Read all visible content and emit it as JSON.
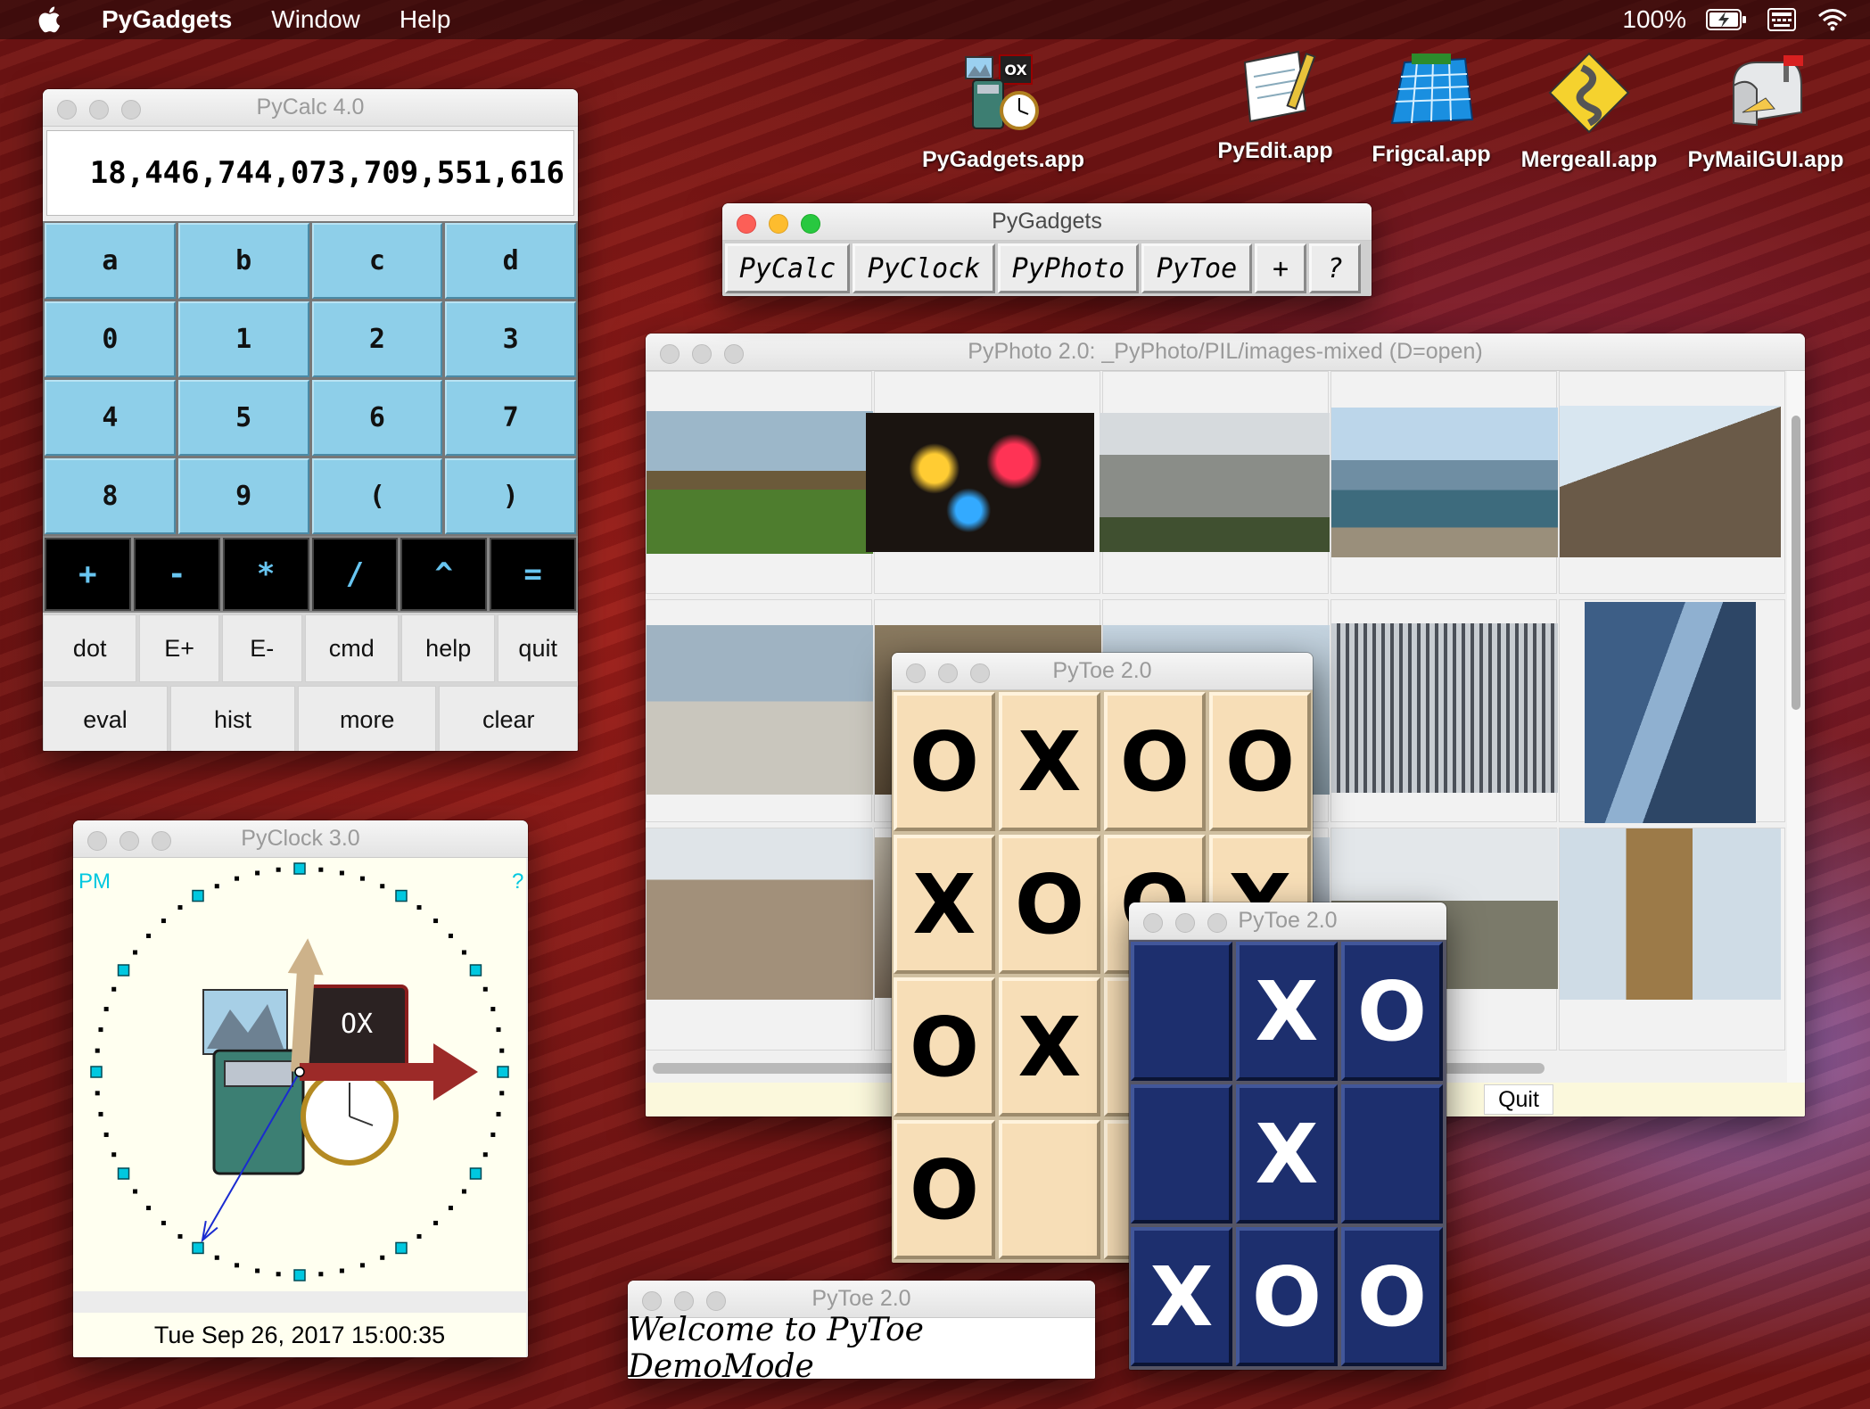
{
  "menubar": {
    "app_name": "PyGadgets",
    "items": [
      "Window",
      "Help"
    ],
    "battery": "100%",
    "icons": [
      "apple-icon",
      "battery-icon",
      "keyboard-icon",
      "wifi-icon"
    ]
  },
  "desktop_icons": [
    {
      "label": "PyGadgets.app",
      "icon": "pygadgets-app-icon"
    },
    {
      "label": "PyEdit.app",
      "icon": "pyedit-app-icon"
    },
    {
      "label": "Frigcal.app",
      "icon": "frigcal-app-icon"
    },
    {
      "label": "Mergeall.app",
      "icon": "mergeall-app-icon"
    },
    {
      "label": "PyMailGUI.app",
      "icon": "pymailgui-app-icon"
    }
  ],
  "pycalc": {
    "title": "PyCalc 4.0",
    "display": "18,446,744,073,709,551,616",
    "keys": [
      "a",
      "b",
      "c",
      "d",
      "0",
      "1",
      "2",
      "3",
      "4",
      "5",
      "6",
      "7",
      "8",
      "9",
      "(",
      ")"
    ],
    "operators": [
      "+",
      "-",
      "*",
      "/",
      "^",
      "="
    ],
    "row1": [
      "dot",
      "E+",
      "E-",
      "cmd",
      "help",
      "quit"
    ],
    "row2": [
      "eval",
      "hist",
      "more",
      "clear"
    ]
  },
  "pygadgets": {
    "title": "PyGadgets",
    "buttons": [
      "PyCalc",
      "PyClock",
      "PyPhoto",
      "PyToe",
      "+",
      "?"
    ]
  },
  "pyphoto": {
    "title": "PyPhoto 2.0: _PyPhoto/PIL/images-mixed (D=open)",
    "quit": "Quit",
    "thumbnails": [
      "park-photo",
      "night-city-photo",
      "castle-photo",
      "harbor-photo",
      "cathedral-photo",
      "beach-photo",
      "street-photo",
      "lake-photo",
      "skyscraper-photo",
      "tower-photo",
      "tower-of-london-photo",
      "market-photo",
      "bridge-photo",
      "church-photo",
      "big-ben-photo"
    ]
  },
  "pytoe_large": {
    "title": "PyToe 2.0",
    "board": [
      [
        "O",
        "X",
        "O",
        "O"
      ],
      [
        "X",
        "O",
        "O",
        "X"
      ],
      [
        "O",
        "X",
        "",
        ""
      ],
      [
        "O",
        "",
        "",
        ""
      ]
    ]
  },
  "pytoe_small": {
    "title": "PyToe 2.0",
    "board": [
      [
        "",
        "X",
        "O"
      ],
      [
        "",
        "X",
        ""
      ],
      [
        "X",
        "O",
        "O"
      ]
    ]
  },
  "pyclock": {
    "title": "PyClock 3.0",
    "ampm": "PM",
    "help": "?",
    "datetime": "Tue Sep 26, 2017 15:00:35",
    "time": {
      "hour": 15,
      "minute": 0,
      "second": 35
    }
  },
  "pytoe_welcome": {
    "title": "PyToe 2.0",
    "message": "Welcome to PyToe DemoMode"
  },
  "colors": {
    "calc_key": "#8ecfe9",
    "calc_operator_text": "#68c5f0",
    "toe_light": "#f7deb7",
    "toe_dark": "#1d2f6e",
    "clock_marks": "#00c8e0",
    "clock_hour_hand": "#cdb28a",
    "clock_minute_hand": "#9c2a28",
    "clock_second_hand": "#1a2bd0"
  }
}
